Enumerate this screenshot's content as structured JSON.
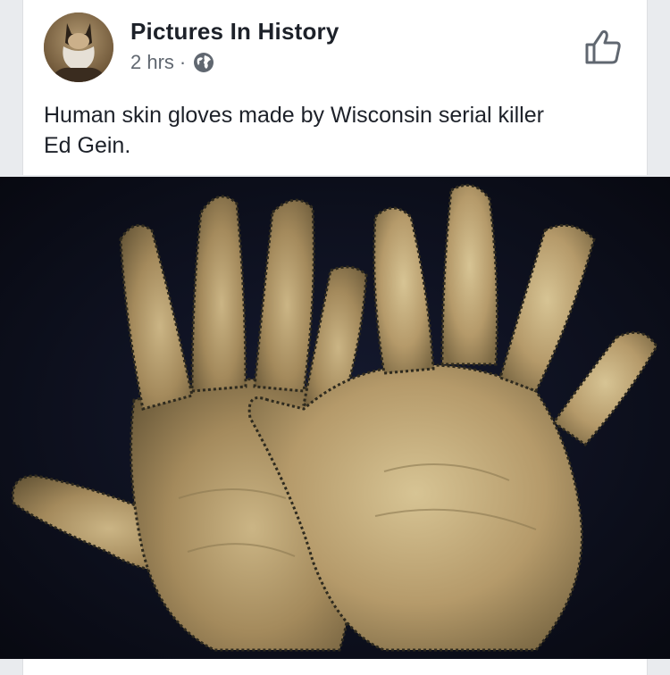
{
  "post": {
    "page_name": "Pictures In History",
    "timestamp": "2 hrs",
    "separator": "·",
    "audience_icon": "globe-icon",
    "caption": "Human skin gloves made by Wisconsin serial killer\nEd Gein.",
    "action_icon": "thumbs-up-icon",
    "image": {
      "subject": "pair of gloves on dark background"
    }
  },
  "colors": {
    "background": "#e9ebee",
    "card": "#ffffff",
    "text_primary": "#1d2129",
    "text_secondary": "#606770",
    "photo_background": "#0c0e1c"
  }
}
